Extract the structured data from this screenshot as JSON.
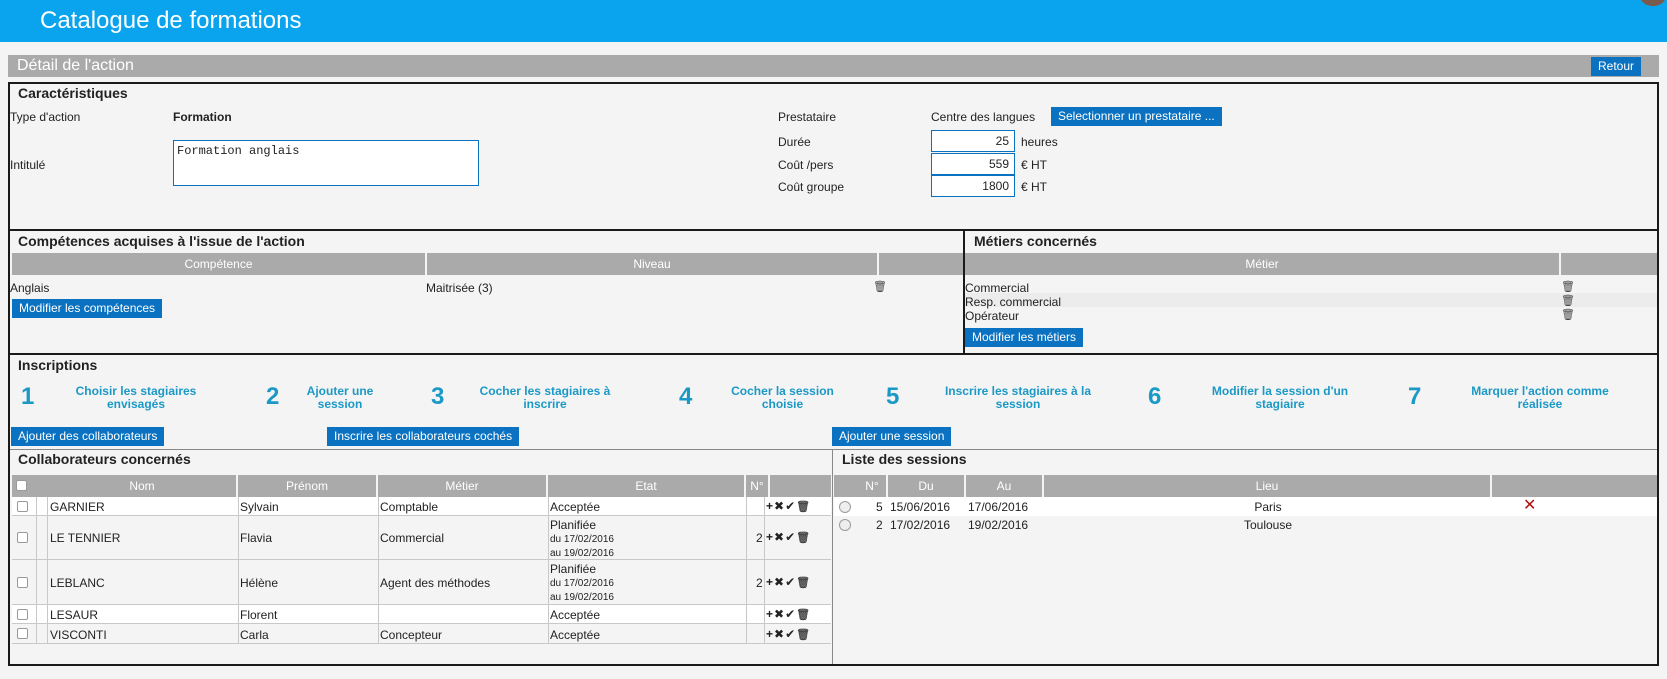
{
  "app": {
    "title": "Catalogue de formations"
  },
  "header": {
    "section_title": "Détail de l'action",
    "back_label": "Retour"
  },
  "characteristics": {
    "heading": "Caractéristiques",
    "type_label": "Type d'action",
    "type_value": "Formation",
    "title_label": "Intitulé",
    "title_value": "Formation anglais",
    "provider_label": "Prestataire",
    "provider_value": "Centre des langues",
    "provider_button": "Selectionner un prestataire ...",
    "duration_label": "Durée",
    "duration_value": "25",
    "duration_unit": "heures",
    "cost_person_label": "Coût /pers",
    "cost_person_value": "559",
    "cost_person_unit": "€ HT",
    "cost_group_label": "Coût groupe",
    "cost_group_value": "1800",
    "cost_group_unit": "€ HT"
  },
  "skills": {
    "heading": "Compétences acquises à  l'issue de l'action",
    "columns": [
      "Compétence",
      "Niveau"
    ],
    "rows": [
      {
        "name": "Anglais",
        "level": "Maitrisée (3)"
      }
    ],
    "button": "Modifier les compétences"
  },
  "jobs": {
    "heading": "Métiers concernés",
    "column": "Métier",
    "rows": [
      "Commercial",
      "Resp. commercial",
      "Opérateur"
    ],
    "button": "Modifier les métiers"
  },
  "registrations": {
    "heading": "Inscriptions",
    "steps": [
      {
        "num": "1",
        "text": "Choisir les stagiaires envisagés"
      },
      {
        "num": "2",
        "text": "Ajouter une session"
      },
      {
        "num": "3",
        "text": "Cocher les stagiaires à inscrire"
      },
      {
        "num": "4",
        "text": "Cocher la session choisie"
      },
      {
        "num": "5",
        "text": "Inscrire les stagiaires à la session"
      },
      {
        "num": "6",
        "text": "Modifier la session d'un stagiaire"
      },
      {
        "num": "7",
        "text": "Marquer l'action comme réalisée"
      }
    ],
    "btn_add_collab": "Ajouter des collaborateurs",
    "btn_register_checked": "Inscrire les collaborateurs cochés",
    "btn_add_session": "Ajouter une session"
  },
  "collaborators": {
    "heading": "Collaborateurs concernés",
    "columns": [
      "Nom",
      "Prénom",
      "Métier",
      "Etat",
      "N°"
    ],
    "rows": [
      {
        "nom": "GARNIER",
        "prenom": "Sylvain",
        "metier": "Comptable",
        "etat": "Acceptée",
        "du": "",
        "au": "",
        "num": ""
      },
      {
        "nom": "LE TENNIER",
        "prenom": "Flavia",
        "metier": "Commercial",
        "etat": "Planifiée",
        "du": "du 17/02/2016",
        "au": "au 19/02/2016",
        "num": "2"
      },
      {
        "nom": "LEBLANC",
        "prenom": "Hélène",
        "metier": "Agent des méthodes",
        "etat": "Planifiée",
        "du": "du 17/02/2016",
        "au": "au 19/02/2016",
        "num": "2"
      },
      {
        "nom": "LESAUR",
        "prenom": "Florent",
        "metier": "",
        "etat": "Acceptée",
        "du": "",
        "au": "",
        "num": ""
      },
      {
        "nom": "VISCONTI",
        "prenom": "Carla",
        "metier": "Concepteur",
        "etat": "Acceptée",
        "du": "",
        "au": "",
        "num": ""
      }
    ],
    "row_actions": "+✖✔"
  },
  "sessions": {
    "heading": "Liste des sessions",
    "columns": [
      "N°",
      "Du",
      "Au",
      "Lieu"
    ],
    "rows": [
      {
        "num": "5",
        "du": "15/06/2016",
        "au": "17/06/2016",
        "lieu": "Paris"
      },
      {
        "num": "2",
        "du": "17/02/2016",
        "au": "19/02/2016",
        "lieu": "Toulouse"
      }
    ]
  },
  "icons": {
    "trash": "trash-icon",
    "delete": "close-icon"
  },
  "colors": {
    "topbar": "#0aa4ee",
    "button": "#0a72c0",
    "step": "#1b99c6",
    "delete": "#b01010"
  }
}
